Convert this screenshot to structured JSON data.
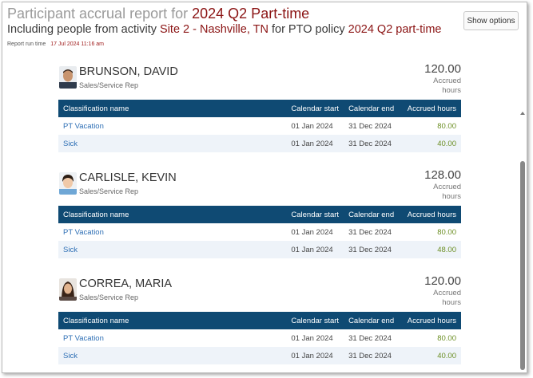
{
  "header": {
    "title_prefix": "Participant accrual report for",
    "title_policy": "2024 Q2 Part-time",
    "subtitle_prefix": "Including people from activity",
    "subtitle_activity": "Site 2 - Nashville, TN",
    "subtitle_middle": "for PTO policy",
    "subtitle_policy": "2024 Q2 part-time",
    "run_label": "Report run time",
    "run_time": "17 Jul 2024 11:16 am"
  },
  "toolbar": {
    "show_options_label": "Show options"
  },
  "table_headers": {
    "classification": "Classification name",
    "calendar_start": "Calendar start",
    "calendar_end": "Calendar end",
    "accrued_hours": "Accrued hours"
  },
  "accrued_label_line1": "Accrued",
  "accrued_label_line2": "hours",
  "people": [
    {
      "name": "BRUNSON, DAVID",
      "role": "Sales/Service Rep",
      "total": "120.00",
      "rows": [
        {
          "classification": "PT Vacation",
          "start": "01 Jan 2024",
          "end": "31 Dec 2024",
          "hours": "80.00"
        },
        {
          "classification": "Sick",
          "start": "01 Jan 2024",
          "end": "31 Dec 2024",
          "hours": "40.00"
        }
      ]
    },
    {
      "name": "CARLISLE, KEVIN",
      "role": "Sales/Service Rep",
      "total": "128.00",
      "rows": [
        {
          "classification": "PT Vacation",
          "start": "01 Jan 2024",
          "end": "31 Dec 2024",
          "hours": "80.00"
        },
        {
          "classification": "Sick",
          "start": "01 Jan 2024",
          "end": "31 Dec 2024",
          "hours": "48.00"
        }
      ]
    },
    {
      "name": "CORREA, MARIA",
      "role": "Sales/Service Rep",
      "total": "120.00",
      "rows": [
        {
          "classification": "PT Vacation",
          "start": "01 Jan 2024",
          "end": "31 Dec 2024",
          "hours": "80.00"
        },
        {
          "classification": "Sick",
          "start": "01 Jan 2024",
          "end": "31 Dec 2024",
          "hours": "40.00"
        }
      ]
    }
  ],
  "colors": {
    "accent_dark_red": "#8b1414",
    "table_header_blue": "#0f4a73",
    "link_blue": "#2e6fb5",
    "hours_green": "#6b8e23"
  }
}
